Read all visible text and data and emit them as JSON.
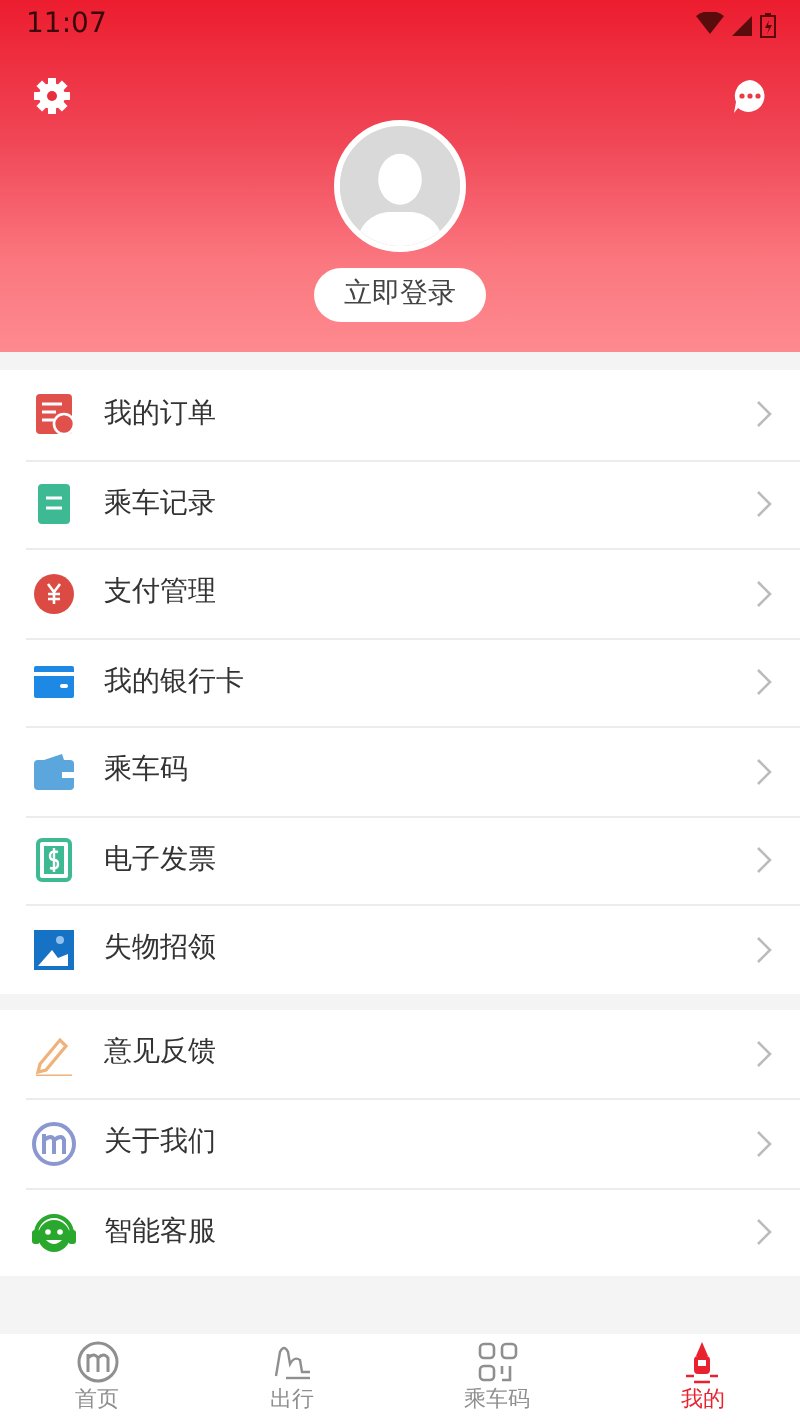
{
  "status_bar": {
    "time": "11:07"
  },
  "header": {
    "login_button": "立即登录"
  },
  "menu_groups": [
    {
      "items": [
        {
          "label": "我的订单"
        },
        {
          "label": "乘车记录"
        },
        {
          "label": "支付管理"
        },
        {
          "label": "我的银行卡"
        },
        {
          "label": "乘车码"
        },
        {
          "label": "电子发票"
        },
        {
          "label": "失物招领"
        }
      ]
    },
    {
      "items": [
        {
          "label": "意见反馈"
        },
        {
          "label": "关于我们"
        },
        {
          "label": "智能客服"
        }
      ]
    }
  ],
  "tab_bar": [
    {
      "label": "首页",
      "selected": false
    },
    {
      "label": "出行",
      "selected": false
    },
    {
      "label": "乘车码",
      "selected": false
    },
    {
      "label": "我的",
      "selected": true
    }
  ]
}
